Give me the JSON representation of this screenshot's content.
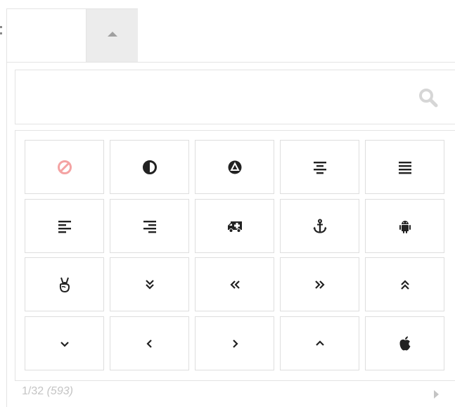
{
  "picker": {
    "selected_value": "",
    "search": {
      "value": "",
      "placeholder": ""
    },
    "footer": {
      "page": "1/32",
      "total": "(593)"
    },
    "colors": {
      "no_icon": "#f4a3a3",
      "icon": "#333333",
      "border": "#dedede",
      "muted": "#c4c4c4",
      "trigger_bg": "#ececec"
    },
    "icons": [
      [
        "ban-icon",
        "adjust-icon",
        "adn-icon",
        "align-center-icon",
        "align-justify-icon"
      ],
      [
        "align-left-icon",
        "align-right-icon",
        "ambulance-icon",
        "anchor-icon",
        "android-icon"
      ],
      [
        "angellist-icon",
        "angle-double-down-icon",
        "angle-double-left-icon",
        "angle-double-right-icon",
        "angle-double-up-icon"
      ],
      [
        "angle-down-icon",
        "angle-left-icon",
        "angle-right-icon",
        "angle-up-icon",
        "apple-icon"
      ]
    ]
  }
}
